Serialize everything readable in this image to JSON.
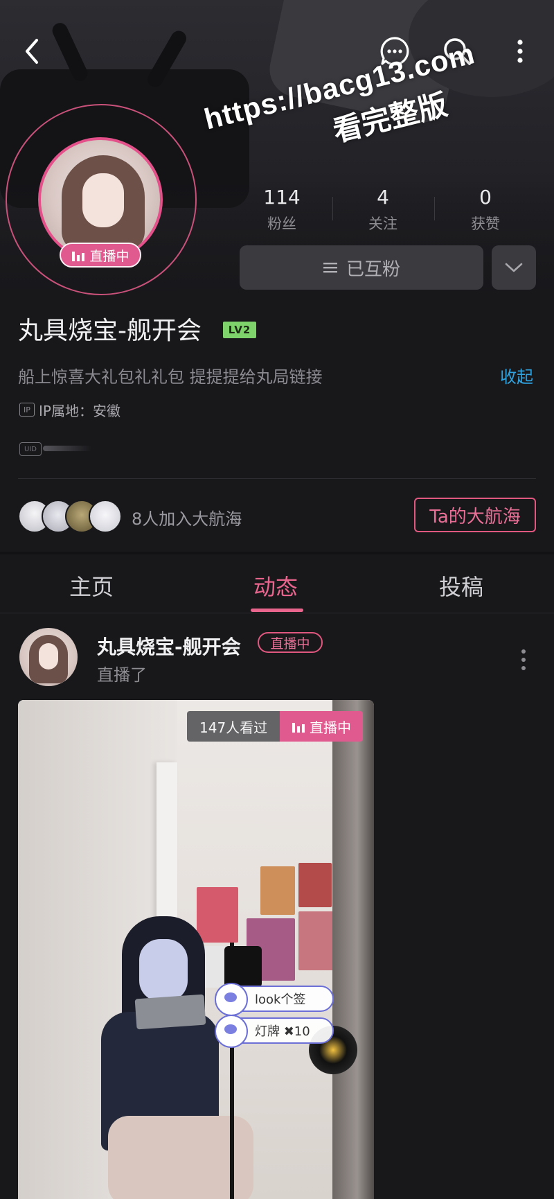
{
  "header": {
    "back_icon": "back-icon",
    "message_icon": "message-icon",
    "search_icon": "search-icon",
    "more_icon": "more-vertical-icon"
  },
  "watermark": {
    "line1": "https://bacg13.com",
    "line2": "看完整版"
  },
  "profile": {
    "live_label": "直播中",
    "name": "丸具烧宝-舰开会",
    "level": "LV2",
    "bio": "船上惊喜大礼包礼礼包   提提提给丸局链接",
    "collapse": "收起",
    "ip_icon": "IP",
    "ip_location": "IP属地：安徽",
    "uid_label": "UID"
  },
  "stats": [
    {
      "value": "114",
      "label": "粉丝"
    },
    {
      "value": "4",
      "label": "关注"
    },
    {
      "value": "0",
      "label": "获赞"
    }
  ],
  "follow": {
    "label": "已互粉",
    "icon": "menu-icon",
    "dropdown_icon": "chevron-down-icon"
  },
  "guard": {
    "text": "8人加入大航海",
    "button": "Ta的大航海"
  },
  "tabs": [
    {
      "label": "主页",
      "active": false
    },
    {
      "label": "动态",
      "active": true
    },
    {
      "label": "投稿",
      "active": false
    }
  ],
  "post": {
    "author": "丸具烧宝-舰开会",
    "badge": "直播中",
    "action": "直播了",
    "viewers": "147人看过",
    "live_label": "直播中",
    "danmaku": [
      "look个签",
      "灯牌 ✖10"
    ]
  },
  "colors": {
    "accent": "#e9658e",
    "link": "#2fa3e0",
    "level_badge": "#7ed36b",
    "background": "#18181b"
  }
}
